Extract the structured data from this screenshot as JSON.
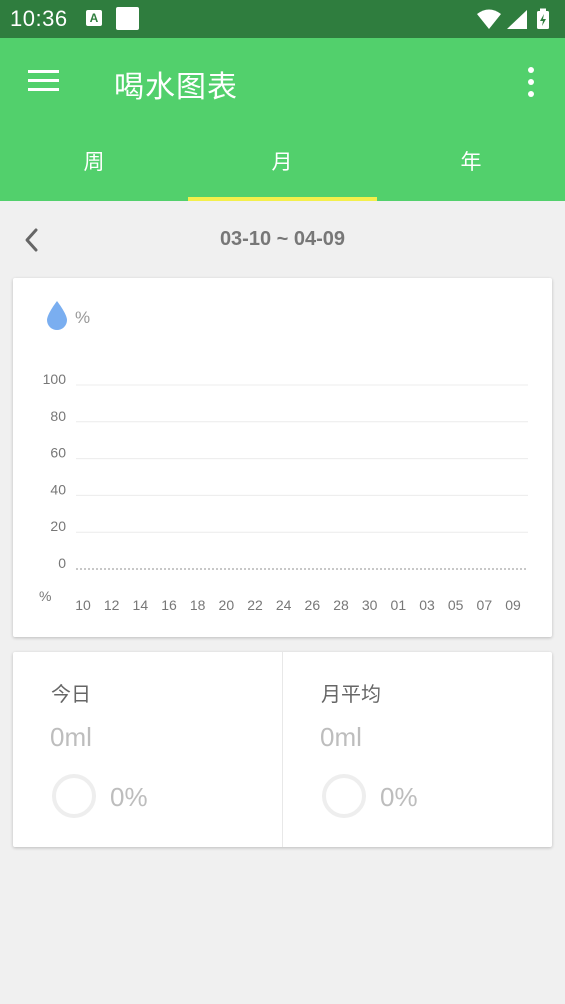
{
  "status_bar": {
    "time": "10:36",
    "indicator_a": "A",
    "icons": [
      "wifi-icon",
      "cell-signal-icon",
      "battery-charging-icon"
    ]
  },
  "app_bar": {
    "title": "喝水图表",
    "menu_icon": "hamburger-menu-icon",
    "more_icon": "more-vert-icon",
    "background": "#52d06c",
    "indicator_color": "#f3ef4b"
  },
  "tabs": [
    {
      "label": "周"
    },
    {
      "label": "月"
    },
    {
      "label": "年"
    }
  ],
  "selected_tab": "月",
  "date_nav": {
    "back_icon": "chevron-left-icon",
    "range": "03-10 ~ 04-09"
  },
  "chart_data": {
    "type": "line",
    "unit_label": "%",
    "x_axis_unit": "%",
    "x": [
      "10",
      "12",
      "14",
      "16",
      "18",
      "20",
      "22",
      "24",
      "26",
      "28",
      "30",
      "01",
      "03",
      "05",
      "07",
      "09"
    ],
    "y_ticks": [
      "100",
      "80",
      "60",
      "40",
      "20",
      "0"
    ],
    "ylim": [
      0,
      100
    ],
    "grid": true,
    "series": [
      {
        "values": [
          0,
          0,
          0,
          0,
          0,
          0,
          0,
          0,
          0,
          0,
          0,
          0,
          0,
          0,
          0,
          0
        ]
      }
    ]
  },
  "stats": [
    {
      "label": "今日",
      "value": "0ml",
      "percent": "0%"
    },
    {
      "label": "月平均",
      "value": "0ml",
      "percent": "0%"
    }
  ]
}
